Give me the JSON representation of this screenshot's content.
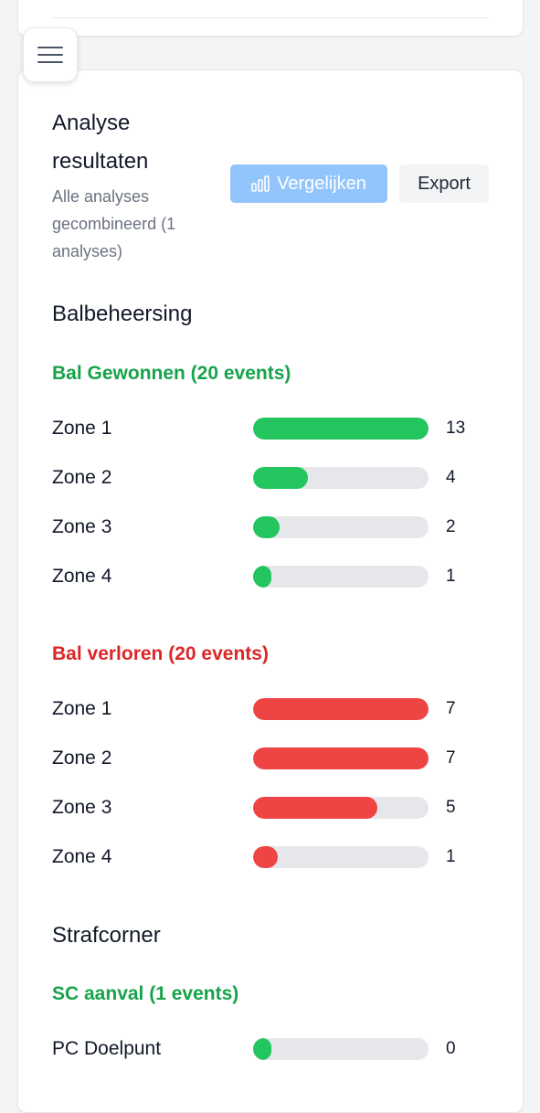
{
  "analysis": {
    "title": "Analyse resultaten",
    "subtitle": "Alle analyses gecombineerd (1 analyses)",
    "compare_label": "Vergelijken",
    "export_label": "Export"
  },
  "colors": {
    "green": "#22c55e",
    "red": "#ef4444",
    "track": "#e5e7eb",
    "compare_button": "#93c5fd"
  },
  "sections": [
    {
      "title": "Balbeheersing",
      "groups": [
        {
          "title": "Bal Gewonnen (20 events)",
          "tone": "green",
          "rows": [
            {
              "label": "Zone 1",
              "value": "13",
              "fill": 1.0
            },
            {
              "label": "Zone 2",
              "value": "4",
              "fill": 0.31
            },
            {
              "label": "Zone 3",
              "value": "2",
              "fill": 0.15
            },
            {
              "label": "Zone 4",
              "value": "1",
              "fill": 0.08
            }
          ]
        },
        {
          "title": "Bal verloren (20 events)",
          "tone": "red",
          "rows": [
            {
              "label": "Zone 1",
              "value": "7",
              "fill": 1.0
            },
            {
              "label": "Zone 2",
              "value": "7",
              "fill": 1.0
            },
            {
              "label": "Zone 3",
              "value": "5",
              "fill": 0.71
            },
            {
              "label": "Zone 4",
              "value": "1",
              "fill": 0.14
            }
          ]
        }
      ]
    },
    {
      "title": "Strafcorner",
      "groups": [
        {
          "title": "SC aanval (1 events)",
          "tone": "green",
          "rows": [
            {
              "label": "PC Doelpunt",
              "value": "0",
              "fill": 0.0
            }
          ]
        }
      ]
    }
  ]
}
